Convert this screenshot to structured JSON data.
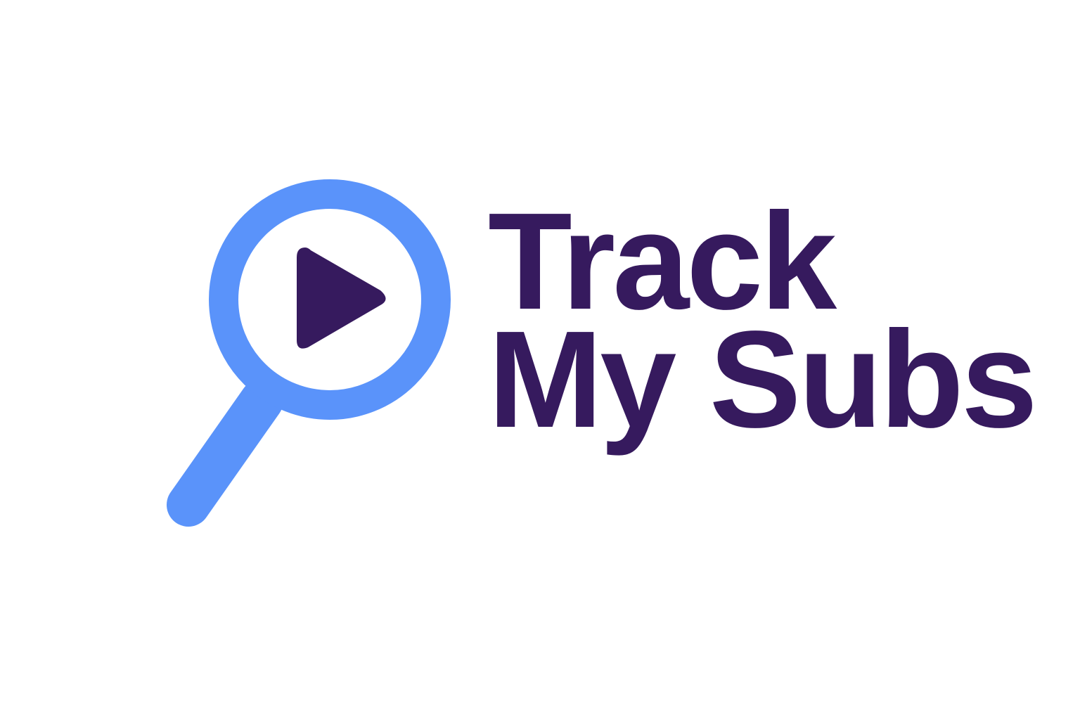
{
  "brand": {
    "line1": "Track",
    "line2": "My Subs"
  },
  "icons": {
    "mark": "magnifying-glass-icon",
    "inner": "play-icon"
  },
  "colors": {
    "background": "#ffffff",
    "lens_blue": "#5a93fa",
    "brand_purple": "#361a5e"
  }
}
